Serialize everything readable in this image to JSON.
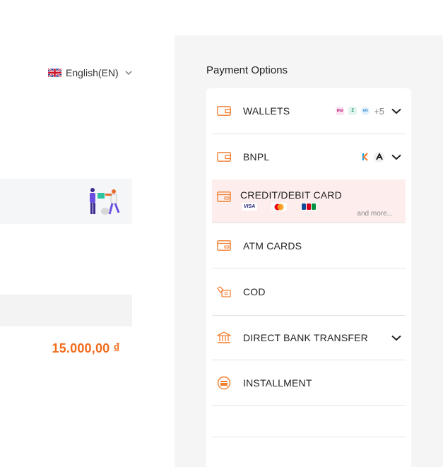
{
  "language": {
    "label": "English(EN)",
    "flag_icon": "uk-flag-icon"
  },
  "order": {
    "total": "15.000,00 ₫",
    "accent": "#f26b1d"
  },
  "payment": {
    "title": "Payment Options",
    "options": [
      {
        "label": "WALLETS",
        "icon": "wallet-icon",
        "more": "+5",
        "expandable": true
      },
      {
        "label": "BNPL",
        "icon": "wallet-icon",
        "expandable": true
      },
      {
        "label": "CREDIT/DEBIT CARD",
        "icon": "card-icon",
        "brands": [
          "VISA",
          "Mastercard",
          "JCB"
        ],
        "more": "and more...",
        "selected": true
      },
      {
        "label": "ATM CARDS",
        "icon": "card-icon"
      },
      {
        "label": "COD",
        "icon": "cash-on-delivery-icon"
      },
      {
        "label": "DIRECT BANK TRANSFER",
        "icon": "bank-icon",
        "expandable": true
      },
      {
        "label": "INSTALLMENT",
        "icon": "installment-icon"
      }
    ],
    "colors": {
      "icon": "#f27d2e",
      "selected_bg": "#fdeeed"
    }
  }
}
